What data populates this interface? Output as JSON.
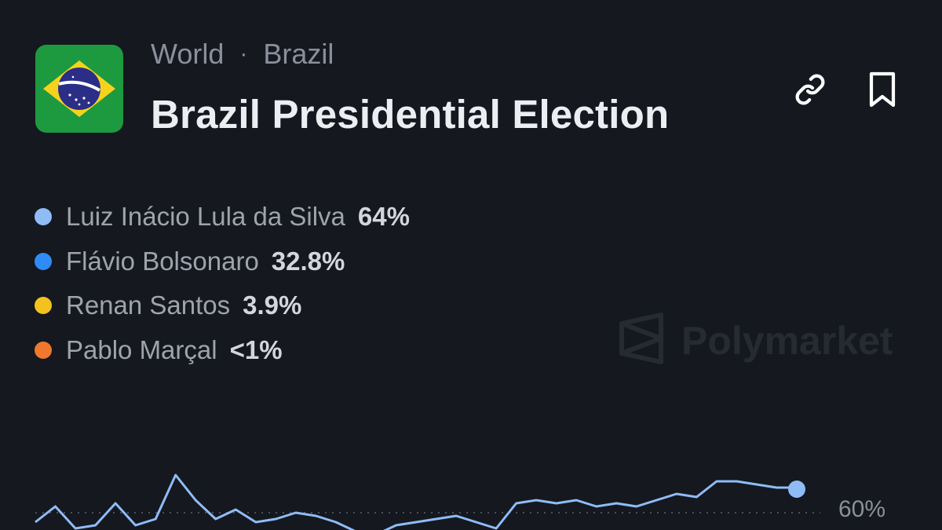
{
  "breadcrumb": {
    "category": "World",
    "separator": "·",
    "subcategory": "Brazil"
  },
  "market": {
    "title": "Brazil Presidential Election",
    "flag_icon": "brazil-flag-icon"
  },
  "actions": {
    "link_icon": "link-icon",
    "bookmark_icon": "bookmark-icon"
  },
  "outcomes": [
    {
      "name": "Luiz Inácio Lula da Silva",
      "percent": "64%",
      "color": "#8fbcf7"
    },
    {
      "name": "Flávio Bolsonaro",
      "percent": "32.8%",
      "color": "#2f8cf6"
    },
    {
      "name": "Renan Santos",
      "percent": "3.9%",
      "color": "#f4c21c"
    },
    {
      "name": "Pablo Marçal",
      "percent": "<1%",
      "color": "#f0782e"
    }
  ],
  "watermark": {
    "brand": "Polymarket",
    "icon": "polymarket-logo-icon"
  },
  "chart_data": {
    "type": "line",
    "y_tick_labels": [
      "60%"
    ],
    "gridline_value": 60,
    "series": [
      {
        "color": "#8fbcf7",
        "values": [
          57,
          62,
          55,
          56,
          63,
          56,
          58,
          72,
          64,
          58,
          61,
          57,
          58,
          60,
          59,
          57,
          54,
          53,
          56,
          57,
          58,
          59,
          57,
          55,
          63,
          64,
          63,
          64,
          62,
          63,
          62,
          64,
          66,
          65,
          70,
          70,
          69,
          68,
          68
        ]
      }
    ],
    "last_value": 67.5
  }
}
